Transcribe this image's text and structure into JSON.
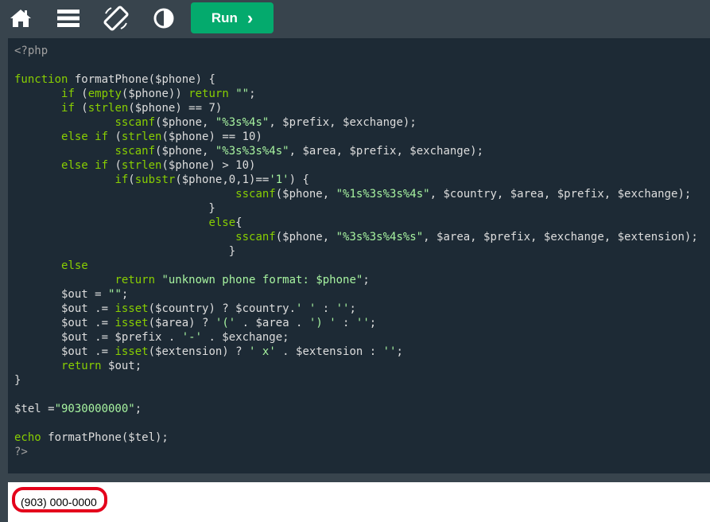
{
  "toolbar": {
    "icons": [
      "home-icon",
      "menu-icon",
      "rotate-icon",
      "theme-contrast-icon"
    ],
    "run_label": "Run",
    "run_arrow": "›"
  },
  "colors": {
    "toolbar_bg": "#38444d",
    "editor_bg": "#1d2a35",
    "run_bg": "#04aa6d",
    "highlight": "#e4001b"
  },
  "editor": {
    "lines": [
      "<?php",
      "",
      "function formatPhone($phone) {",
      "       if (empty($phone)) return \"\";",
      "       if (strlen($phone) == 7)",
      "               sscanf($phone, \"%3s%4s\", $prefix, $exchange);",
      "       else if (strlen($phone) == 10)",
      "               sscanf($phone, \"%3s%3s%4s\", $area, $prefix, $exchange);",
      "       else if (strlen($phone) > 10)",
      "               if(substr($phone,0,1)=='1') {",
      "                                 sscanf($phone, \"%1s%3s%3s%4s\", $country, $area, $prefix, $exchange);",
      "                             }",
      "                             else{",
      "                                 sscanf($phone, \"%3s%3s%4s%s\", $area, $prefix, $exchange, $extension);",
      "                                }",
      "       else",
      "               return \"unknown phone format: $phone\";",
      "       $out = \"\";",
      "       $out .= isset($country) ? $country.' ' : '';",
      "       $out .= isset($area) ? '(' . $area . ') ' : '';",
      "       $out .= $prefix . '-' . $exchange;",
      "       $out .= isset($extension) ? ' x' . $extension : '';",
      "       return $out;",
      "}",
      "",
      "$tel =\"9030000000\";",
      "",
      "echo formatPhone($tel);",
      "?>"
    ]
  },
  "output": {
    "text": "(903) 000-0000"
  }
}
